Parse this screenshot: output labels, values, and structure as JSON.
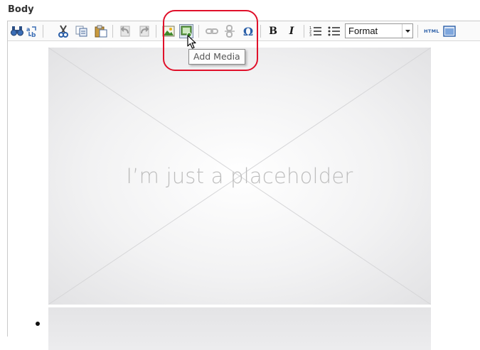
{
  "field": {
    "label": "Body"
  },
  "toolbar": {
    "bold_label": "B",
    "italic_label": "I",
    "format_value": "Format",
    "html_label": "HTML",
    "special_char_label": "Ω"
  },
  "tooltip": {
    "text": "Add Media"
  },
  "placeholder": {
    "text": "I’m just a placeholder"
  },
  "colors": {
    "callout": "#e0112b",
    "hover_bg": "#dce6f2"
  }
}
